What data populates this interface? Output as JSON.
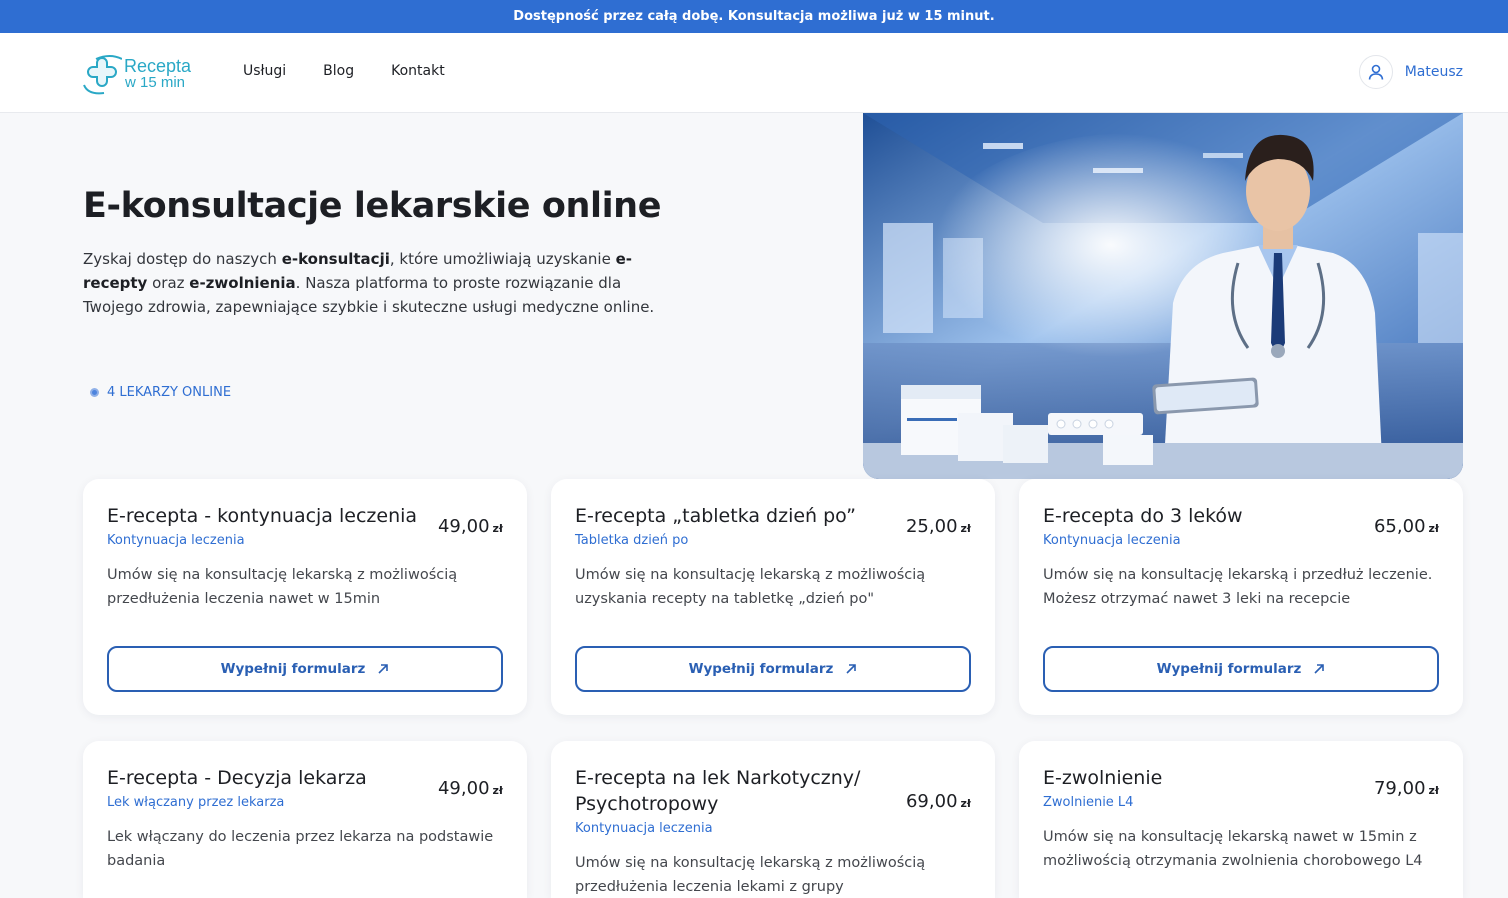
{
  "topbar": {
    "text": "Dostępność przez całą dobę. Konsultacja możliwa już w 15 minut."
  },
  "logo": {
    "line1": "Recepta",
    "line2": "w 15 min"
  },
  "nav": {
    "items": [
      {
        "label": "Usługi"
      },
      {
        "label": "Blog"
      },
      {
        "label": "Kontakt"
      }
    ]
  },
  "user": {
    "name": "Mateusz"
  },
  "hero": {
    "title": "E-konsultacje lekarskie online",
    "desc": {
      "p1": "Zyskaj dostęp do naszych ",
      "b1": "e-konsultacji",
      "p2": ", które umożliwiają uzyskanie ",
      "b2": "e-recepty",
      "p3": " oraz ",
      "b3": "e-zwolnienia",
      "p4": ". Nasza platforma to proste rozwiązanie dla Twojego zdrowia, zapewniające szybkie i skuteczne usługi medyczne online."
    },
    "online_label": "4 LEKARZY ONLINE"
  },
  "icons": {
    "user": "user-icon",
    "external": "arrow-up-right-icon",
    "online": "status-dot-icon"
  },
  "colors": {
    "accent": "#2f6ed2",
    "button_border": "#2a5fb3"
  },
  "cards": [
    {
      "title": "E-recepta - kontynuacja leczenia",
      "price": "49,00",
      "currency": "zł",
      "subtitle": "Kontynuacja leczenia",
      "desc": "Umów się na konsultację lekarską z możliwością przedłużenia leczenia nawet w 15min",
      "button": "Wypełnij formularz"
    },
    {
      "title": "E-recepta „tabletka dzień po”",
      "price": "25,00",
      "currency": "zł",
      "subtitle": "Tabletka dzień po",
      "desc": "Umów się na konsultację lekarską z możliwością uzyskania recepty na tabletkę „dzień po\"",
      "button": "Wypełnij formularz"
    },
    {
      "title": "E-recepta do 3 leków",
      "price": "65,00",
      "currency": "zł",
      "subtitle": "Kontynuacja leczenia",
      "desc": "Umów się na konsultację lekarską i przedłuż leczenie. Możesz otrzymać nawet 3 leki na recepcie",
      "button": "Wypełnij formularz"
    },
    {
      "title": "E-recepta - Decyzja lekarza",
      "price": "49,00",
      "currency": "zł",
      "subtitle": "Lek włączany przez lekarza",
      "desc": "Lek włączany do leczenia przez lekarza na podstawie badania"
    },
    {
      "title": "E-recepta na lek Narkotyczny/ Psychotropowy",
      "price": "69,00",
      "currency": "zł",
      "subtitle": "Kontynuacja leczenia",
      "desc": "Umów się na konsultację lekarską z możliwością przedłużenia leczenia lekami z grupy"
    },
    {
      "title": "E-zwolnienie",
      "price": "79,00",
      "currency": "zł",
      "subtitle": "Zwolnienie L4",
      "desc": "Umów się na konsultację lekarską nawet w 15min z możliwością otrzymania zwolnienia chorobowego L4"
    }
  ]
}
